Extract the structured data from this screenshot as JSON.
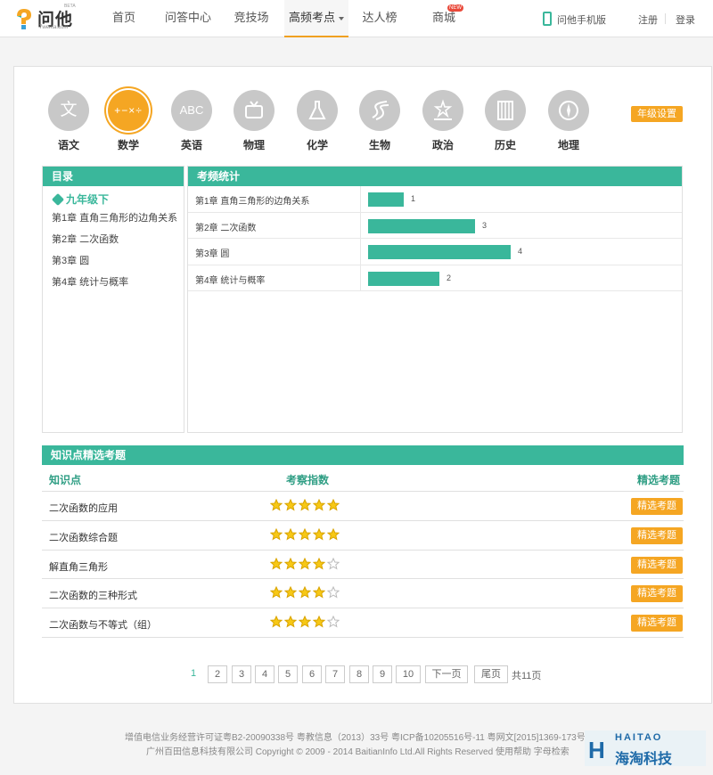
{
  "header": {
    "logo_text": "问他",
    "logo_sub": "7wenta.com",
    "logo_beta": "BETA",
    "nav": [
      {
        "label": "首页"
      },
      {
        "label": "问答中心"
      },
      {
        "label": "竞技场"
      },
      {
        "label": "高频考点"
      },
      {
        "label": "达人榜"
      },
      {
        "label": "商城"
      }
    ],
    "new_badge": "NEW",
    "mobile_label": "问他手机版",
    "register": "注册",
    "login": "登录"
  },
  "subjects": [
    {
      "label": "语文",
      "glyph": "文"
    },
    {
      "label": "数学",
      "glyph": "+−×÷"
    },
    {
      "label": "英语",
      "glyph": "ABC"
    },
    {
      "label": "物理",
      "glyph": ""
    },
    {
      "label": "化学",
      "glyph": ""
    },
    {
      "label": "生物",
      "glyph": ""
    },
    {
      "label": "政治",
      "glyph": ""
    },
    {
      "label": "历史",
      "glyph": ""
    },
    {
      "label": "地理",
      "glyph": ""
    }
  ],
  "grade_settings": "年级设置",
  "catalog": {
    "title": "目录",
    "grade": "九年级下",
    "chapters": [
      "第1章 直角三角形的边角关系",
      "第2章 二次函数",
      "第3章 圆",
      "第4章 统计与概率"
    ]
  },
  "stats": {
    "title": "考频统计",
    "chart_data": {
      "type": "bar",
      "categories": [
        "第1章 直角三角形的边角关系",
        "第2章 二次函数",
        "第3章 圆",
        "第4章 统计与概率"
      ],
      "values": [
        1,
        3,
        4,
        2
      ],
      "xlim": [
        0,
        4
      ]
    }
  },
  "knowledge": {
    "title": "知识点精选考题",
    "col_name": "知识点",
    "col_index": "考察指数",
    "col_pick": "精选考题",
    "rows": [
      {
        "name": "二次函数的应用",
        "stars": 5,
        "btn": "精选考题"
      },
      {
        "name": "二次函数综合题",
        "stars": 5,
        "btn": "精选考题"
      },
      {
        "name": "解直角三角形",
        "stars": 4,
        "btn": "精选考题"
      },
      {
        "name": "二次函数的三种形式",
        "stars": 4,
        "btn": "精选考题"
      },
      {
        "name": "二次函数与不等式（组）",
        "stars": 4,
        "btn": "精选考题"
      }
    ]
  },
  "pager": {
    "pages": [
      "1",
      "2",
      "3",
      "4",
      "5",
      "6",
      "7",
      "8",
      "9",
      "10"
    ],
    "next": "下一页",
    "last": "尾页",
    "total": "共11页"
  },
  "footer": {
    "line1": "增值电信业务经营许可证粤B2-20090338号 粤教信息（2013）33号 粤ICP备10205516号-11 粤网文[2015]1369-173号",
    "line2": "广州百田信息科技有限公司 Copyright © 2009 - 2014 BaitianInfo Ltd.All Rights Reserved 使用帮助 字母检索"
  },
  "watermark": {
    "top": "HAITAO",
    "text": "海淘科技"
  },
  "colors": {
    "accent": "#3ab79b",
    "orange": "#f5a623",
    "inactive": "#c8c8c8"
  }
}
